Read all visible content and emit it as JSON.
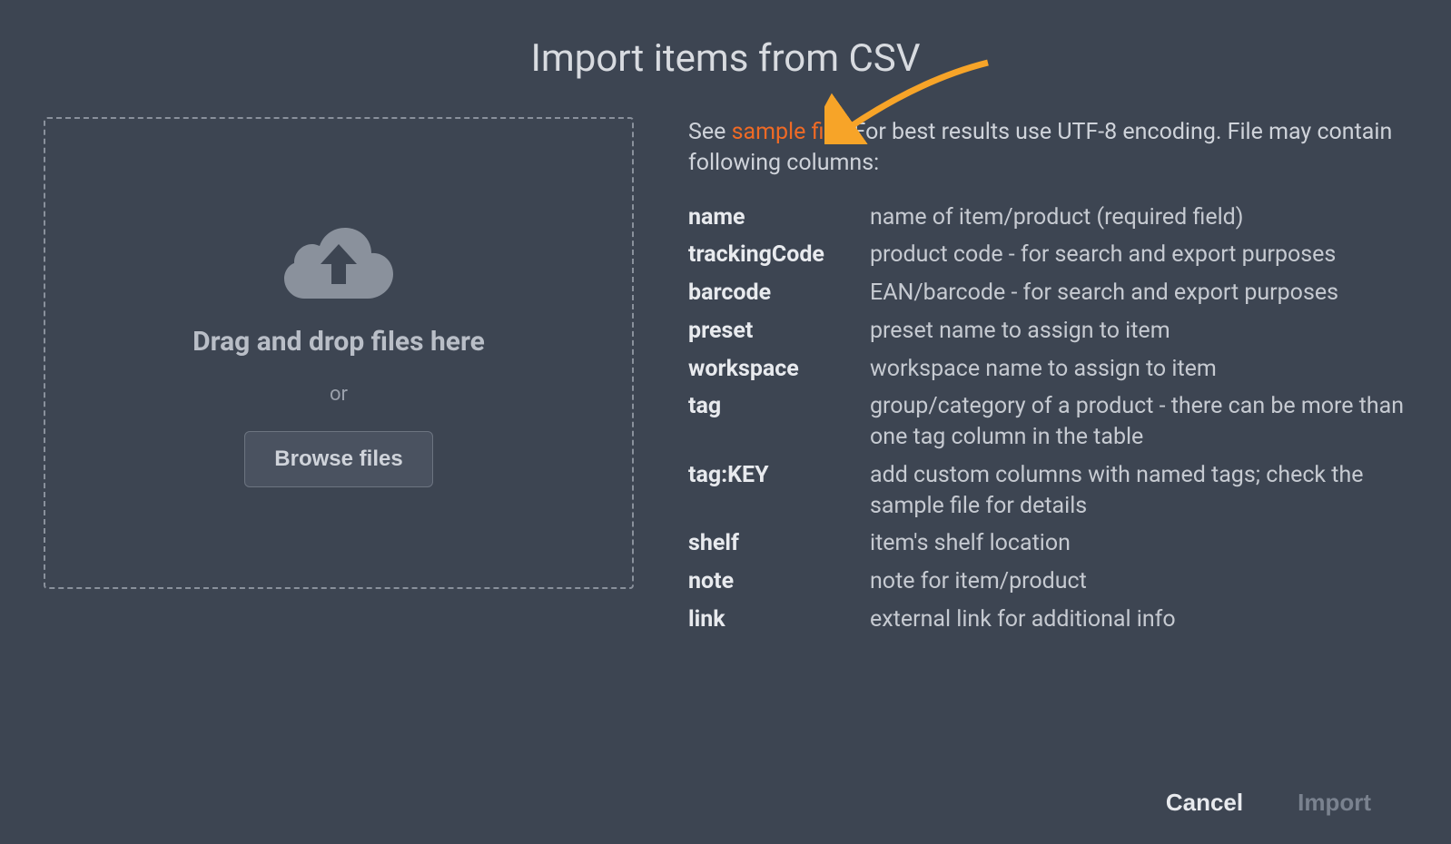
{
  "dialog": {
    "title": "Import items from CSV"
  },
  "dropzone": {
    "heading": "Drag and drop files here",
    "or": "or",
    "browse": "Browse files"
  },
  "info": {
    "see": "See ",
    "sample_link": "sample file",
    "after_link": ". For best results use UTF-8 encoding. File may contain following columns:"
  },
  "columns": [
    {
      "name": "name",
      "desc": "name of item/product (required field)"
    },
    {
      "name": "trackingCode",
      "desc": "product code - for search and export purposes"
    },
    {
      "name": "barcode",
      "desc": "EAN/barcode - for search and export purposes"
    },
    {
      "name": "preset",
      "desc": "preset name to assign to item"
    },
    {
      "name": "workspace",
      "desc": "workspace name to assign to item"
    },
    {
      "name": "tag",
      "desc": "group/category of a product - there can be more than one tag column in the table"
    },
    {
      "name": "tag:KEY",
      "desc": "add custom columns with named tags; check the sample file for details"
    },
    {
      "name": "shelf",
      "desc": "item's shelf location"
    },
    {
      "name": "note",
      "desc": "note for item/product"
    },
    {
      "name": "link",
      "desc": "external link for additional info"
    }
  ],
  "buttons": {
    "cancel": "Cancel",
    "import": "Import"
  }
}
